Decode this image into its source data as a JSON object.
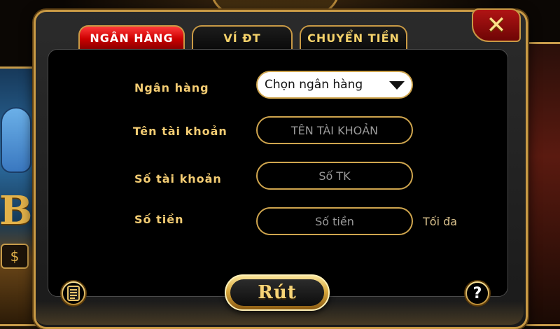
{
  "tabs": [
    {
      "label": "NGÂN HÀNG",
      "active": true
    },
    {
      "label": "VÍ ĐT",
      "active": false
    },
    {
      "label": "CHUYỂN TIỀN",
      "active": false
    }
  ],
  "form": {
    "bank_label": "Ngân hàng",
    "bank_select_value": "Chọn ngân hàng",
    "account_name_label": "Tên tài khoản",
    "account_name_placeholder": "TÊN TÀI KHOẢN",
    "account_number_label": "Số tài khoản",
    "account_number_placeholder": "Số TK",
    "amount_label": "Số tiền",
    "amount_placeholder": "Số tiền",
    "max_label": "Tối đa"
  },
  "actions": {
    "submit_label": "Rút",
    "help_symbol": "?",
    "close_symbol": "✕"
  },
  "icons": {
    "close": "close-icon",
    "history": "document-icon",
    "help": "help-icon",
    "dropdown": "chevron-down-icon"
  },
  "colors": {
    "gold": "#c99a45",
    "label_gold": "#f3cc73",
    "active_tab_red": "#c00000",
    "panel_bg": "#1a1a1a"
  }
}
